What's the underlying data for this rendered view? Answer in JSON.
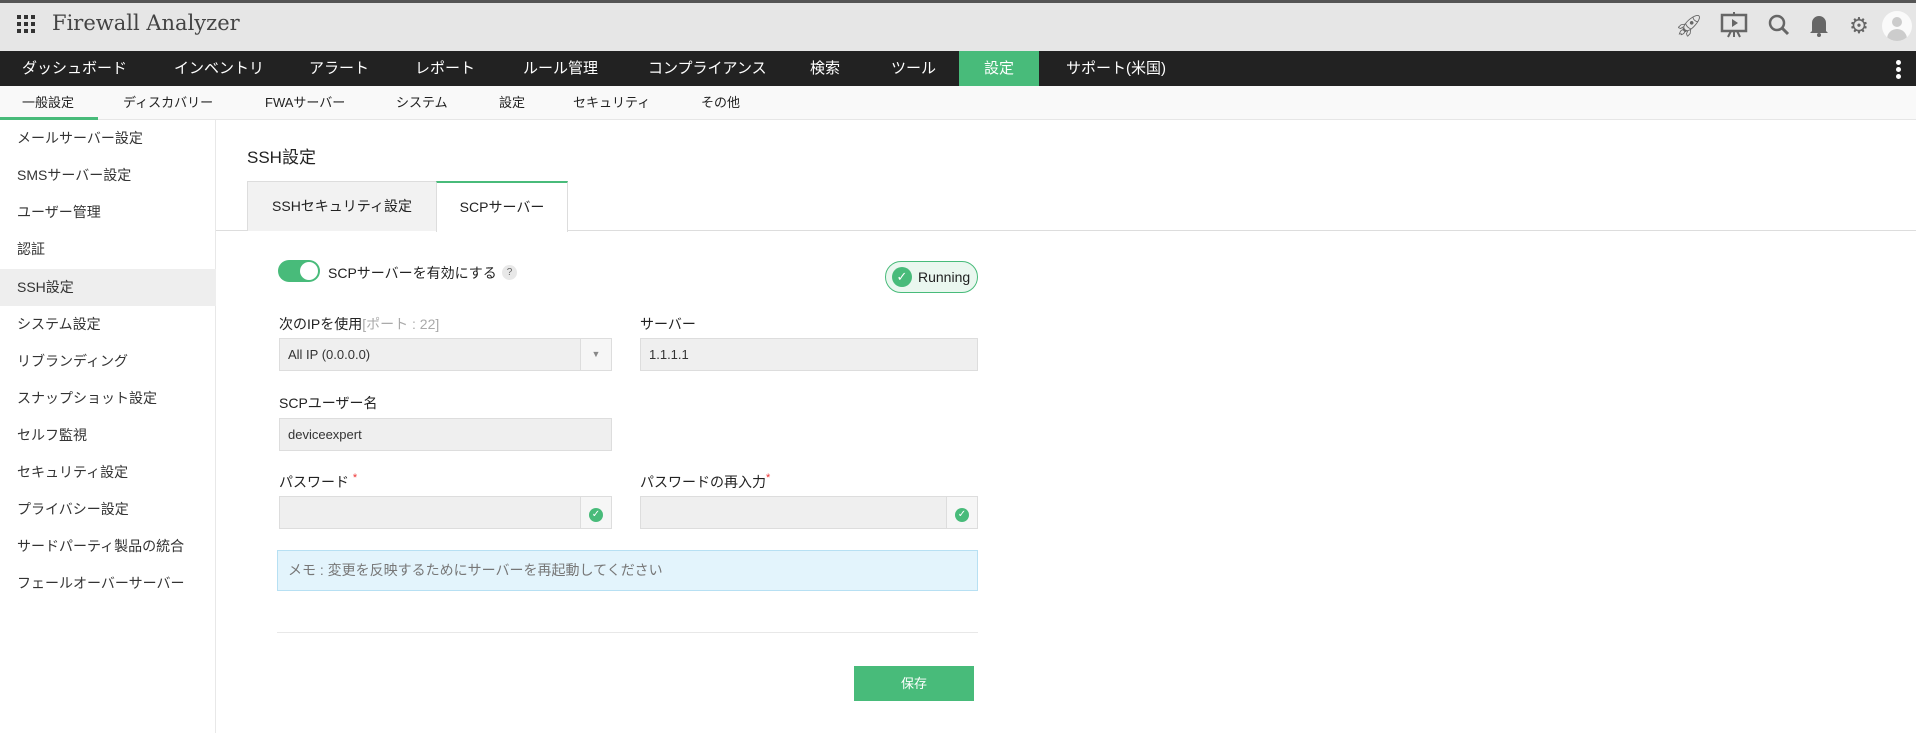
{
  "header": {
    "title": "Firewall Analyzer",
    "icons": [
      "rocket-icon",
      "presentation-icon",
      "search-icon",
      "bell-icon",
      "gear-icon",
      "avatar"
    ]
  },
  "nav": {
    "items": [
      "ダッシュボード",
      "インベントリ",
      "アラート",
      "レポート",
      "ルール管理",
      "コンプライアンス",
      "検索",
      "ツール",
      "設定",
      "サポート(米国)"
    ],
    "active": "設定"
  },
  "subnav": {
    "items": [
      "一般設定",
      "ディスカバリー",
      "FWAサーバー",
      "システム",
      "設定",
      "セキュリティ",
      "その他"
    ],
    "active": "一般設定"
  },
  "sidebar": {
    "items": [
      "メールサーバー設定",
      "SMSサーバー設定",
      "ユーザー管理",
      "認証",
      "SSH設定",
      "システム設定",
      "リブランディング",
      "スナップショット設定",
      "セルフ監視",
      "セキュリティ設定",
      "プライバシー設定",
      "サードパーティ製品の統合",
      "フェールオーバーサーバー"
    ],
    "active": "SSH設定"
  },
  "page": {
    "title": "SSH設定",
    "tabs": [
      "SSHセキュリティ設定",
      "SCPサーバー"
    ],
    "active_tab": "SCPサーバー"
  },
  "form": {
    "enable_label": "SCPサーバーを有効にする",
    "enable_on": true,
    "help": "?",
    "status": "Running",
    "ip_label": "次のIPを使用",
    "ip_hint": "[ポート : 22]",
    "ip_value": "All IP (0.0.0.0)",
    "server_label": "サーバー",
    "server_value": "1.1.1.1",
    "user_label": "SCPユーザー名",
    "user_value": "deviceexpert",
    "password_label": "パスワード",
    "password_confirm_label": "パスワードの再入力",
    "required": "*",
    "memo": "メモ : 変更を反映するためにサーバーを再起動してください",
    "save": "保存"
  },
  "colors": {
    "accent": "#48bb7a",
    "nav_bg": "#222222"
  }
}
